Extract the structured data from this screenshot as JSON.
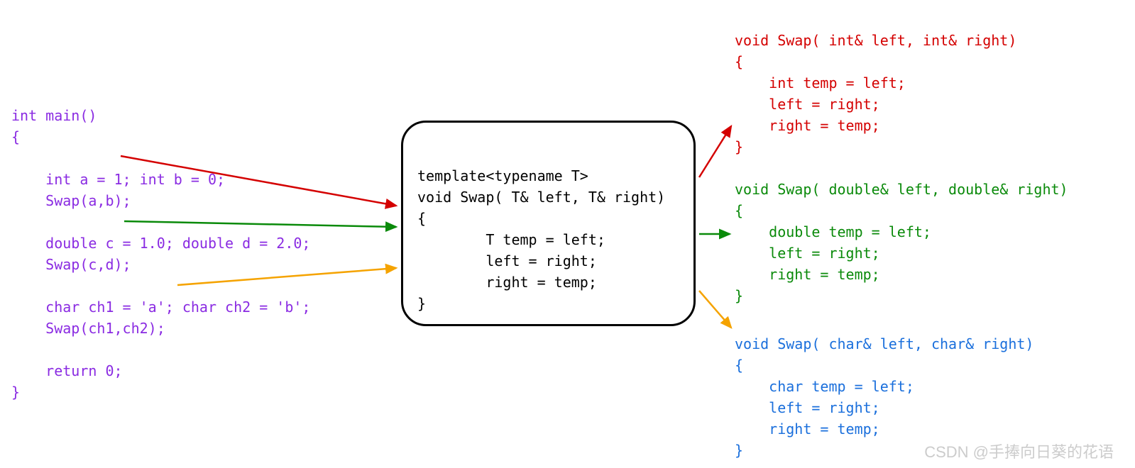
{
  "main_code": {
    "l1": "int main()",
    "l2": "{",
    "l3": "    int a = 1; int b = 0;",
    "l4": "    Swap(a,b);",
    "l5": "    double c = 1.0; double d = 2.0;",
    "l6": "    Swap(c,d);",
    "l7": "    char ch1 = 'a'; char ch2 = 'b';",
    "l8": "    Swap(ch1,ch2);",
    "l9": "    return 0;",
    "l10": "}"
  },
  "template_code": {
    "l1": "template<typename T>",
    "l2": "void Swap( T& left, T& right)",
    "l3": "{",
    "l4": "        T temp = left;",
    "l5": "        left = right;",
    "l6": "        right = temp;",
    "l7": "}"
  },
  "int_swap": {
    "l1": "void Swap( int& left, int& right)",
    "l2": "{",
    "l3": "    int temp = left;",
    "l4": "    left = right;",
    "l5": "    right = temp;",
    "l6": "}"
  },
  "double_swap": {
    "l1": "void Swap( double& left, double& right)",
    "l2": "{",
    "l3": "    double temp = left;",
    "l4": "    left = right;",
    "l5": "    right = temp;",
    "l6": "}"
  },
  "char_swap": {
    "l1": "void Swap( char& left, char& right)",
    "l2": "{",
    "l3": "    char temp = left;",
    "l4": "    left = right;",
    "l5": "    right = temp;",
    "l6": "}"
  },
  "watermark": "CSDN @手捧向日葵的花语",
  "colors": {
    "red": "#d40000",
    "green": "#0a8a0a",
    "orange": "#f5a300",
    "blue": "#1a6fdc",
    "purple": "#8a2be2"
  }
}
